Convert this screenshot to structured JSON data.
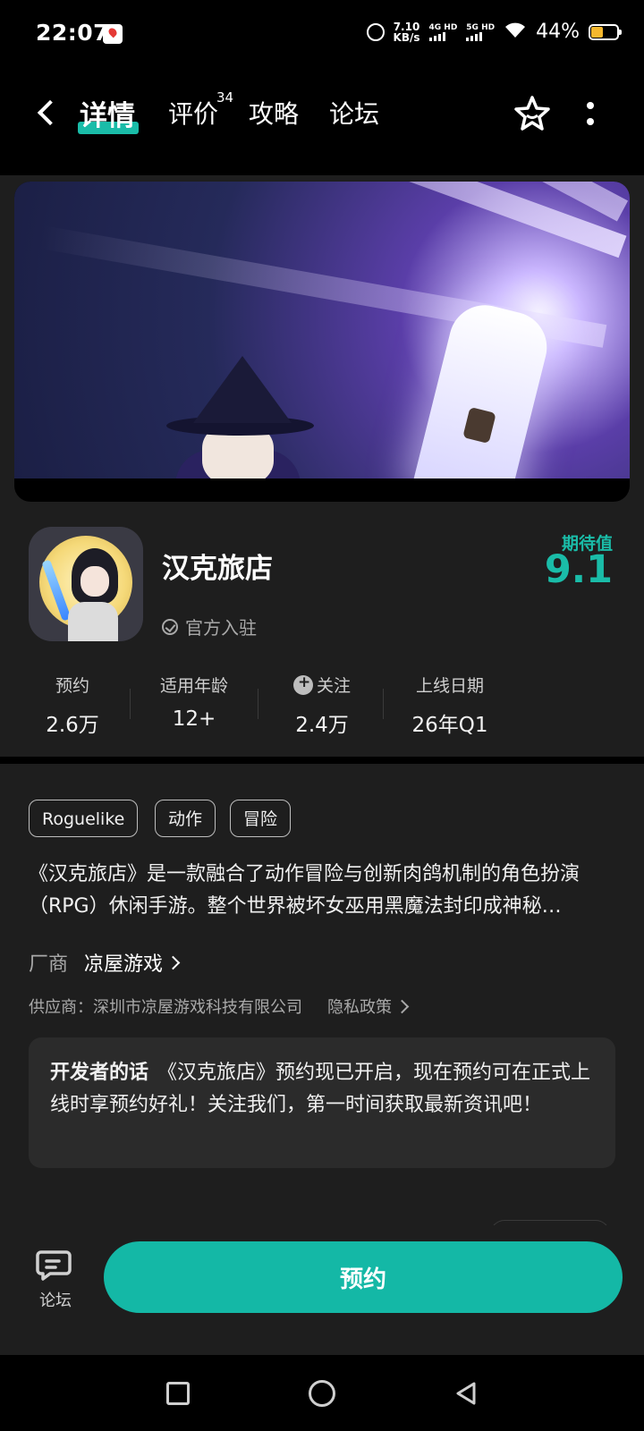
{
  "status_bar": {
    "time": "22:07",
    "net_speed_value": "7.10",
    "net_speed_unit": "KB/s",
    "sim1": "4G HD",
    "sim2": "5G HD",
    "battery_pct": "44%",
    "battery_level": 0.44
  },
  "header": {
    "tabs": [
      {
        "label": "详情",
        "active": true
      },
      {
        "label": "评价",
        "count": "34"
      },
      {
        "label": "攻略"
      },
      {
        "label": "论坛"
      }
    ]
  },
  "app": {
    "name": "汉克旅店",
    "verified_label": "官方入驻",
    "expect_label": "期待值",
    "expect_value": "9.1",
    "stats": [
      {
        "label": "预约",
        "value": "2.6万"
      },
      {
        "label": "适用年龄",
        "value": "12+"
      },
      {
        "label": "关注",
        "value": "2.4万"
      },
      {
        "label": "上线日期",
        "value": "26年Q1"
      }
    ],
    "tags": [
      "Roguelike",
      "动作",
      "冒险"
    ],
    "description": "《汉克旅店》是一款融合了动作冒险与创新肉鸽机制的角色扮演（RPG）休闲手游。整个世界被坏女巫用黑魔法封印成神秘…",
    "vendor_label": "厂商",
    "vendor_name": "凉屋游戏",
    "supplier": "供应商：深圳市凉屋游戏科技有限公司",
    "privacy": "隐私政策",
    "dev_note_title": "开发者的话",
    "dev_note_text": "《汉克旅店》预约现已开启，现在预约可在正式上线时享预约好礼！关注我们，第一时间获取最新资讯吧！"
  },
  "bottom": {
    "forum_label": "论坛",
    "reserve_label": "预约"
  },
  "colors": {
    "accent": "#14b8a6",
    "background": "#1e1e1e"
  }
}
